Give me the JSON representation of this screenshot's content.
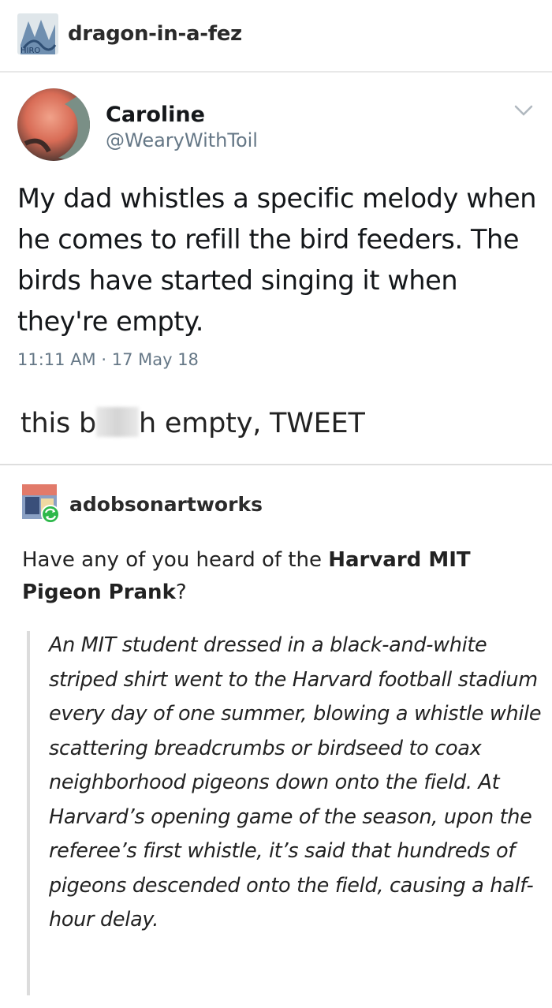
{
  "original_post": {
    "username": "dragon-in-a-fez"
  },
  "tweet": {
    "display_name": "Caroline",
    "handle": "@WearyWithToil",
    "text": "My dad whistles a specific melody when he comes to refill the bird feeders. The birds have started singing it when they're empty.",
    "timestamp": "11:11 AM · 17 May 18",
    "menu_icon": "chevron-down-icon"
  },
  "comment": {
    "before": "this b",
    "after": "h empty, TWEET"
  },
  "reblog": {
    "username": "adobsonartworks",
    "intro_before": "Have any of you heard of the ",
    "intro_bold": "Harvard MIT Pigeon Prank",
    "intro_after": "?",
    "quote": "An MIT student dressed in a  black-and-white striped shirt went to the Harvard football stadium every  day of one summer, blowing a whistle while scattering breadcrumbs or  birdseed to coax neighborhood pigeons down onto the field. At  Harvard’s opening game of the season, upon the referee’s first whistle,  it’s said that hundreds of pigeons descended onto the field, causing a  half-hour delay."
  },
  "colors": {
    "handle_gray": "#657786",
    "tweet_text": "#14171a",
    "divider": "#dedede",
    "quote_border": "#dcdcdc"
  }
}
